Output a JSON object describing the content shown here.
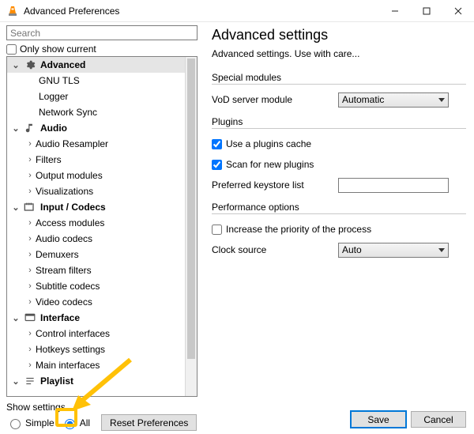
{
  "window": {
    "title": "Advanced Preferences"
  },
  "search": {
    "placeholder": "Search"
  },
  "only_show_current": "Only show current",
  "tree": {
    "advanced": {
      "label": "Advanced",
      "children": {
        "gnu": "GNU TLS",
        "logger": "Logger",
        "net": "Network Sync"
      }
    },
    "audio": {
      "label": "Audio",
      "children": {
        "resamp": "Audio Resampler",
        "filters": "Filters",
        "out": "Output modules",
        "vis": "Visualizations"
      }
    },
    "input": {
      "label": "Input / Codecs",
      "children": {
        "access": "Access modules",
        "ac": "Audio codecs",
        "demux": "Demuxers",
        "sf": "Stream filters",
        "sc": "Subtitle codecs",
        "vc": "Video codecs"
      }
    },
    "interface": {
      "label": "Interface",
      "children": {
        "ci": "Control interfaces",
        "hk": "Hotkeys settings",
        "mi": "Main interfaces"
      }
    },
    "playlist": {
      "label": "Playlist"
    }
  },
  "show_settings": {
    "title": "Show settings",
    "simple": "Simple",
    "all": "All",
    "reset": "Reset Preferences"
  },
  "right": {
    "heading": "Advanced settings",
    "subtitle": "Advanced settings. Use with care...",
    "sec_special": "Special modules",
    "vod_label": "VoD server module",
    "vod_value": "Automatic",
    "sec_plugins": "Plugins",
    "use_cache": "Use a plugins cache",
    "scan_new": "Scan for new plugins",
    "keystore_label": "Preferred keystore list",
    "sec_perf": "Performance options",
    "increase_prio": "Increase the priority of the process",
    "clock_label": "Clock source",
    "clock_value": "Auto"
  },
  "buttons": {
    "save": "Save",
    "cancel": "Cancel"
  }
}
